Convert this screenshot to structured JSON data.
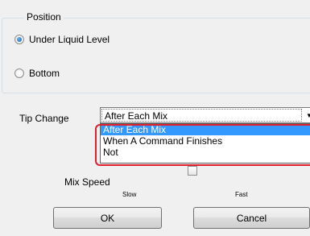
{
  "position_group": {
    "title": "Position",
    "options": [
      {
        "label": "Under Liquid Level",
        "selected": true
      },
      {
        "label": "Bottom",
        "selected": false
      }
    ]
  },
  "tip_change": {
    "label": "Tip Change",
    "selected_value": "After Each Mix",
    "dropdown_items": [
      "After Each Mix",
      "When A Command Finishes",
      "Not"
    ],
    "arrow_icon": "▼"
  },
  "mix_speed": {
    "label": "Mix Speed",
    "slow_label": "Slow",
    "fast_label": "Fast"
  },
  "buttons": {
    "ok": "OK",
    "cancel": "Cancel"
  },
  "colors": {
    "selection": "#3399ff",
    "highlight_border": "#e21f2d"
  }
}
